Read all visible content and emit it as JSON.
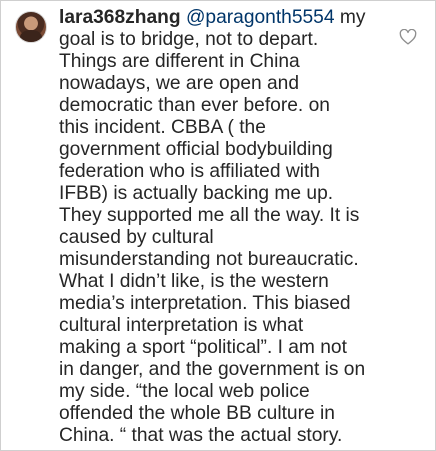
{
  "comment": {
    "username": "lara368zhang",
    "mention": "@paragonth5554",
    "first_line_tail": " my",
    "lines": [
      "goal is to bridge, not to depart.",
      "Things are different in China",
      "nowadays, we are open and",
      "democratic than ever before.  on",
      "this incident. CBBA ( the",
      "government official bodybuilding",
      "federation who is affiliated with",
      "IFBB) is actually backing me up.",
      "They supported me all the way. It is",
      "caused by cultural",
      "misunderstanding not bureaucratic.",
      "What I didn’t like, is the western",
      "media’s interpretation. This biased",
      "cultural interpretation is what",
      "making a sport “political”. I am not",
      "in danger, and the government is on",
      "my side. “the local web police",
      "offended the whole BB culture in",
      "China. “ that was the actual story."
    ]
  },
  "icons": {
    "avatar": "user-avatar",
    "like": "heart-outline-icon"
  },
  "colors": {
    "text": "#262626",
    "mention": "#003569",
    "border": "#cfcfcf",
    "icon": "#8e8e8e"
  }
}
